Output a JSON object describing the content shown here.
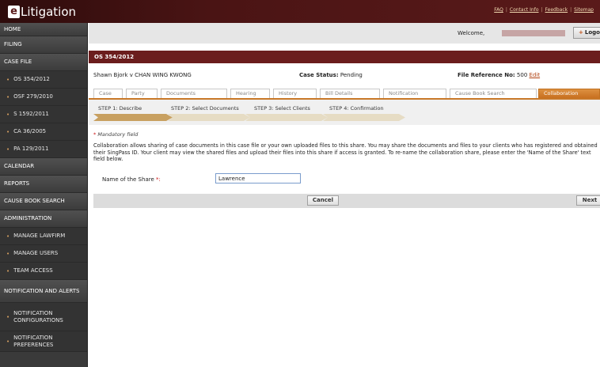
{
  "app": {
    "logo_letter": "e",
    "logo_text": "Litigation",
    "top_links": [
      "FAQ",
      "Contact Info",
      "Feedback",
      "Sitemap"
    ]
  },
  "sidebar": {
    "items": [
      {
        "label": "HOME",
        "type": "top"
      },
      {
        "label": "FILING",
        "type": "top"
      },
      {
        "label": "CASE FILE",
        "type": "top"
      },
      {
        "label": "OS 354/2012",
        "type": "sub"
      },
      {
        "label": "OSF 279/2010",
        "type": "sub"
      },
      {
        "label": "S 1592/2011",
        "type": "sub"
      },
      {
        "label": "CA 36/2005",
        "type": "sub"
      },
      {
        "label": "PA 129/2011",
        "type": "sub"
      },
      {
        "label": "CALENDAR",
        "type": "top"
      },
      {
        "label": "REPORTS",
        "type": "top"
      },
      {
        "label": "CAUSE BOOK SEARCH",
        "type": "top"
      },
      {
        "label": "ADMINISTRATION",
        "type": "top"
      },
      {
        "label": "MANAGE LAWFIRM",
        "type": "sub"
      },
      {
        "label": "MANAGE USERS",
        "type": "sub"
      },
      {
        "label": "TEAM ACCESS",
        "type": "sub"
      },
      {
        "label": "NOTIFICATION AND ALERTS",
        "type": "top"
      },
      {
        "label": "NOTIFICATION CONFIGURATIONS",
        "type": "sub"
      },
      {
        "label": "NOTIFICATION PREFERENCES",
        "type": "sub"
      }
    ]
  },
  "header": {
    "welcome": "Welcome,",
    "logout_label": "Logo"
  },
  "case": {
    "title": "OS 354/2012",
    "parties": "Shawn Bjork v CHAN WING KWONG",
    "status_label": "Case Status:",
    "status_value": "Pending",
    "file_ref_label": "File Reference No:",
    "file_ref_value": "500",
    "edit_label": "Edit"
  },
  "tabs": [
    {
      "label": "Case",
      "active": false
    },
    {
      "label": "Party",
      "active": false
    },
    {
      "label": "Documents",
      "active": false
    },
    {
      "label": "Hearing",
      "active": false
    },
    {
      "label": "History",
      "active": false
    },
    {
      "label": "Bill Details",
      "active": false
    },
    {
      "label": "Notification",
      "active": false
    },
    {
      "label": "Cause Book Search",
      "active": false
    },
    {
      "label": "Collaboration",
      "active": true
    }
  ],
  "steps": [
    {
      "label": "STEP 1: Describe",
      "state": "current"
    },
    {
      "label": "STEP 2: Select Documents",
      "state": "pending"
    },
    {
      "label": "STEP 3: Select Clients",
      "state": "pending"
    },
    {
      "label": "STEP 4: Confirmation",
      "state": "pending"
    }
  ],
  "form": {
    "mandatory_star": "*",
    "mandatory_text": "Mandatory field",
    "description": "Collaboration allows sharing of case documents in this case file or your own uploaded files to this share. You may share the documents and files to your clients who has registered and obtained their SingPass ID. Your client may view the shared files and upload their files into this share if access is granted. To re-name the collaboration share, please enter the 'Name of the Share' text field below.",
    "share_name_label": "Name of the Share",
    "share_name_star": "*:",
    "share_name_value": "Lawrence",
    "cancel_label": "Cancel",
    "next_label": "Next"
  },
  "colors": {
    "banner": "#4a1414",
    "case_bar": "#6b1d1d",
    "active_tab": "#c87020",
    "step_current": "#c8a060",
    "step_pending": "#e6dcc4"
  }
}
